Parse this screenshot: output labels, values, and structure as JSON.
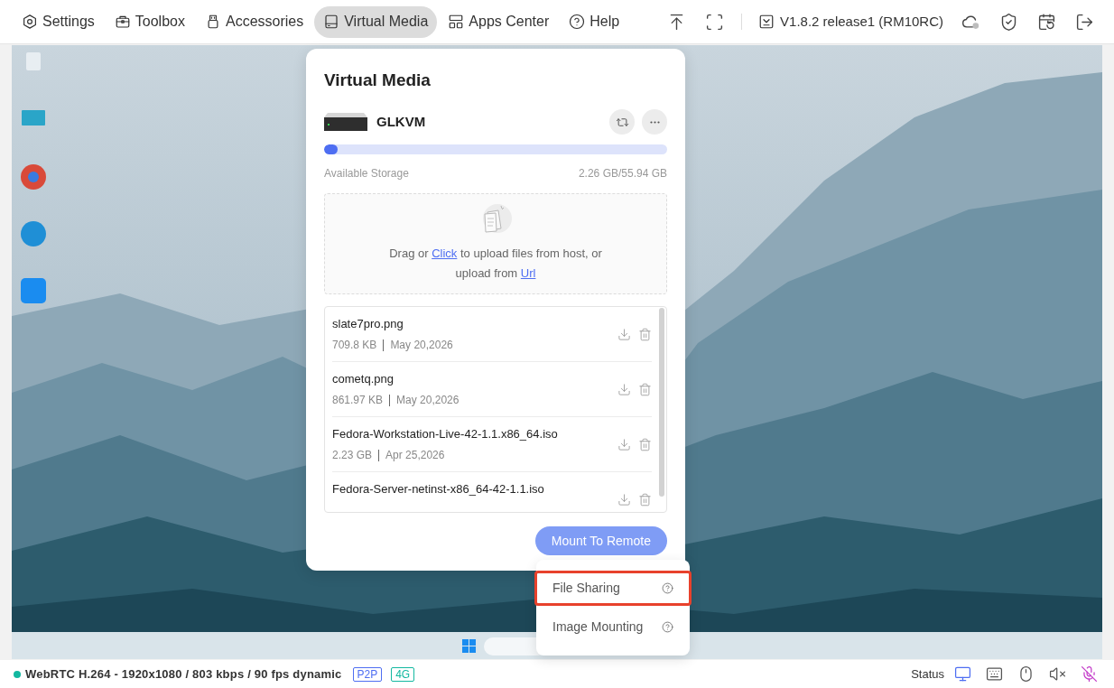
{
  "nav": {
    "tabs": [
      {
        "kind": "settings",
        "label": "Settings",
        "selected": false
      },
      {
        "kind": "toolbox",
        "label": "Toolbox",
        "selected": false
      },
      {
        "kind": "accessories",
        "label": "Accessories",
        "selected": false
      },
      {
        "kind": "virtual_media",
        "label": "Virtual Media",
        "selected": true
      },
      {
        "kind": "apps",
        "label": "Apps Center",
        "selected": false
      },
      {
        "kind": "help",
        "label": "Help",
        "selected": false
      }
    ],
    "version": "V1.8.2 release1 (RM10RC)",
    "cloud_connected": false
  },
  "virtual_media": {
    "title": "Virtual Media",
    "device": "GLKVM",
    "storage": {
      "label": "Available Storage",
      "reading": "2.26 GB/55.94 GB",
      "level": 0.04
    },
    "upload_hint": {
      "lines": [
        [
          {
            "kind": "text",
            "text": "Drag or"
          },
          {
            "kind": "link",
            "text": "Click"
          },
          {
            "kind": "text",
            "text": "to upload files from host, or"
          }
        ],
        [
          {
            "kind": "text",
            "text": "upload from"
          },
          {
            "kind": "link",
            "text": "Url"
          }
        ]
      ]
    },
    "files": [
      {
        "name": "slate7pro.png",
        "size": "709.8 KB",
        "date": "May 20,2026"
      },
      {
        "name": "cometq.png",
        "size": "861.97 KB",
        "date": "May 20,2026"
      },
      {
        "name": "Fedora-Workstation-Live-42-1.1.x86_64.iso",
        "size": "2.23 GB",
        "date": "Apr 25,2026"
      },
      {
        "name": "Fedora-Server-netinst-x86_64-42-1.1.iso"
      }
    ],
    "mount_button": {
      "label": "Mount To Remote",
      "disabled": true
    }
  },
  "menu": {
    "items": [
      {
        "label": "File Sharing",
        "highlighted": true
      },
      {
        "label": "Image Mounting",
        "highlighted": false
      }
    ]
  },
  "status_bar": {
    "connected": true,
    "stream": "WebRTC H.264 - 1920x1080 / 803 kbps / 90 fps dynamic",
    "badges": [
      {
        "label": "P2P",
        "color": "#4e6ef2"
      },
      {
        "label": "4G",
        "color": "#13b8a0"
      }
    ],
    "status_label": "Status",
    "indicators": [
      {
        "kind": "monitor",
        "active": true
      },
      {
        "kind": "keyboard",
        "active": false
      },
      {
        "kind": "mouse",
        "active": false
      },
      {
        "kind": "speaker",
        "active": false
      },
      {
        "kind": "microphone",
        "active": false
      }
    ]
  }
}
